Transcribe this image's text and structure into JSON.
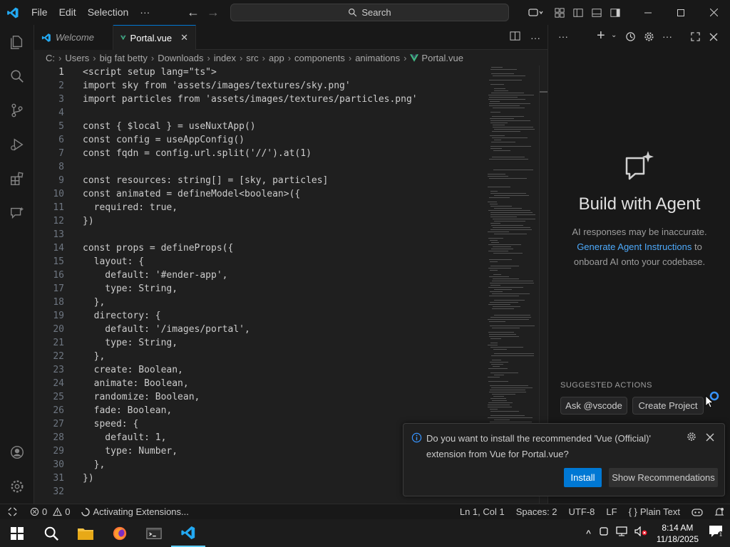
{
  "menu": {
    "file": "File",
    "edit": "Edit",
    "selection": "Selection",
    "more": "···"
  },
  "search": {
    "label": "Search"
  },
  "tabs": [
    {
      "label": "Welcome",
      "icon": "vscode-icon"
    },
    {
      "label": "Portal.vue",
      "icon": "vue-icon",
      "close": "✕"
    }
  ],
  "breadcrumb": [
    "C:",
    "Users",
    "big fat betty",
    "Downloads",
    "index",
    "src",
    "app",
    "components",
    "animations",
    "Portal.vue"
  ],
  "code_lines": [
    {
      "n": "1",
      "t": "<script setup lang=\"ts\">"
    },
    {
      "n": "2",
      "t": "import sky from 'assets/images/textures/sky.png'"
    },
    {
      "n": "3",
      "t": "import particles from 'assets/images/textures/particles.png'"
    },
    {
      "n": "4",
      "t": ""
    },
    {
      "n": "5",
      "t": "const { $local } = useNuxtApp()"
    },
    {
      "n": "6",
      "t": "const config = useAppConfig()"
    },
    {
      "n": "7",
      "t": "const fqdn = config.url.split('//').at(1)"
    },
    {
      "n": "8",
      "t": ""
    },
    {
      "n": "9",
      "t": "const resources: string[] = [sky, particles]"
    },
    {
      "n": "10",
      "t": "const animated = defineModel<boolean>({"
    },
    {
      "n": "11",
      "t": "  required: true,"
    },
    {
      "n": "12",
      "t": "})"
    },
    {
      "n": "13",
      "t": ""
    },
    {
      "n": "14",
      "t": "const props = defineProps({"
    },
    {
      "n": "15",
      "t": "  layout: {"
    },
    {
      "n": "16",
      "t": "    default: '#ender-app',"
    },
    {
      "n": "17",
      "t": "    type: String,"
    },
    {
      "n": "18",
      "t": "  },"
    },
    {
      "n": "19",
      "t": "  directory: {"
    },
    {
      "n": "20",
      "t": "    default: '/images/portal',"
    },
    {
      "n": "21",
      "t": "    type: String,"
    },
    {
      "n": "22",
      "t": "  },"
    },
    {
      "n": "23",
      "t": "  create: Boolean,"
    },
    {
      "n": "24",
      "t": "  animate: Boolean,"
    },
    {
      "n": "25",
      "t": "  randomize: Boolean,"
    },
    {
      "n": "26",
      "t": "  fade: Boolean,"
    },
    {
      "n": "27",
      "t": "  speed: {"
    },
    {
      "n": "28",
      "t": "    default: 1,"
    },
    {
      "n": "29",
      "t": "    type: Number,"
    },
    {
      "n": "30",
      "t": "  },"
    },
    {
      "n": "31",
      "t": "})"
    },
    {
      "n": "32",
      "t": ""
    }
  ],
  "chat": {
    "title": "Build with Agent",
    "subtitle": "AI responses may be inaccurate.",
    "link": "Generate Agent Instructions",
    "after_link": " to",
    "line3": "onboard AI onto your codebase.",
    "suggested_label": "SUGGESTED ACTIONS",
    "chips": [
      "Ask @vscode",
      "Create Project"
    ]
  },
  "notification": {
    "message": "Do you want to install the recommended 'Vue (Official)' extension from Vue for Portal.vue?",
    "install": "Install",
    "show": "Show Recommendations"
  },
  "status": {
    "errors": "0",
    "warnings": "0",
    "activity": "Activating Extensions...",
    "position": "Ln 1, Col 1",
    "spaces": "Spaces: 2",
    "encoding": "UTF-8",
    "eol": "LF",
    "language": "Plain Text",
    "braces": "{ }"
  },
  "clock": {
    "time": "8:14 AM",
    "date": "11/18/2025"
  },
  "colors": {
    "accent": "#0078d4",
    "vue_green": "#41b883",
    "link": "#4daafc"
  }
}
